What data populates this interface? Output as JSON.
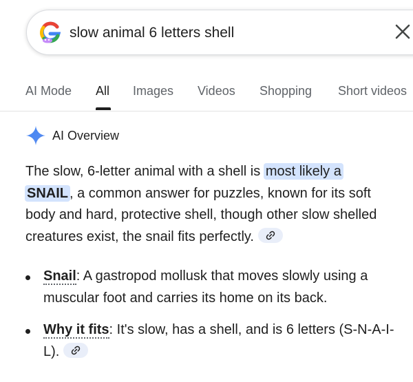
{
  "search": {
    "query": "slow animal 6 letters shell"
  },
  "tabs": [
    {
      "label": "AI Mode",
      "active": false
    },
    {
      "label": "All",
      "active": true
    },
    {
      "label": "Images",
      "active": false
    },
    {
      "label": "Videos",
      "active": false
    },
    {
      "label": "Shopping",
      "active": false
    },
    {
      "label": "Short videos",
      "active": false
    }
  ],
  "ai_overview": {
    "title": "AI Overview",
    "intro_before": "The slow, 6-letter animal with a shell is ",
    "intro_highlight_1": "most likely a",
    "intro_highlight_2": "SNAIL",
    "intro_after": ", a common answer for puzzles, known for its soft body and hard, protective shell, though other slow shelled creatures exist, the snail fits perfectly.",
    "bullets": [
      {
        "term": "Snail",
        "text": ": A gastropod mollusk that moves slowly using a muscular foot and carries its home on its back."
      },
      {
        "term": "Why it fits",
        "text": ": It's slow, has a shell, and is 6 letters (S-N-A-I-L)."
      }
    ]
  },
  "colors": {
    "highlight": "#d3e3fd",
    "accent_blue": "#4285f4",
    "text": "#1f1f1f",
    "tab_inactive": "#5f6368"
  },
  "icons": {
    "logo": "google-g-icon",
    "clear": "close-icon",
    "ai": "sparkle-icon",
    "citation": "link-icon"
  }
}
